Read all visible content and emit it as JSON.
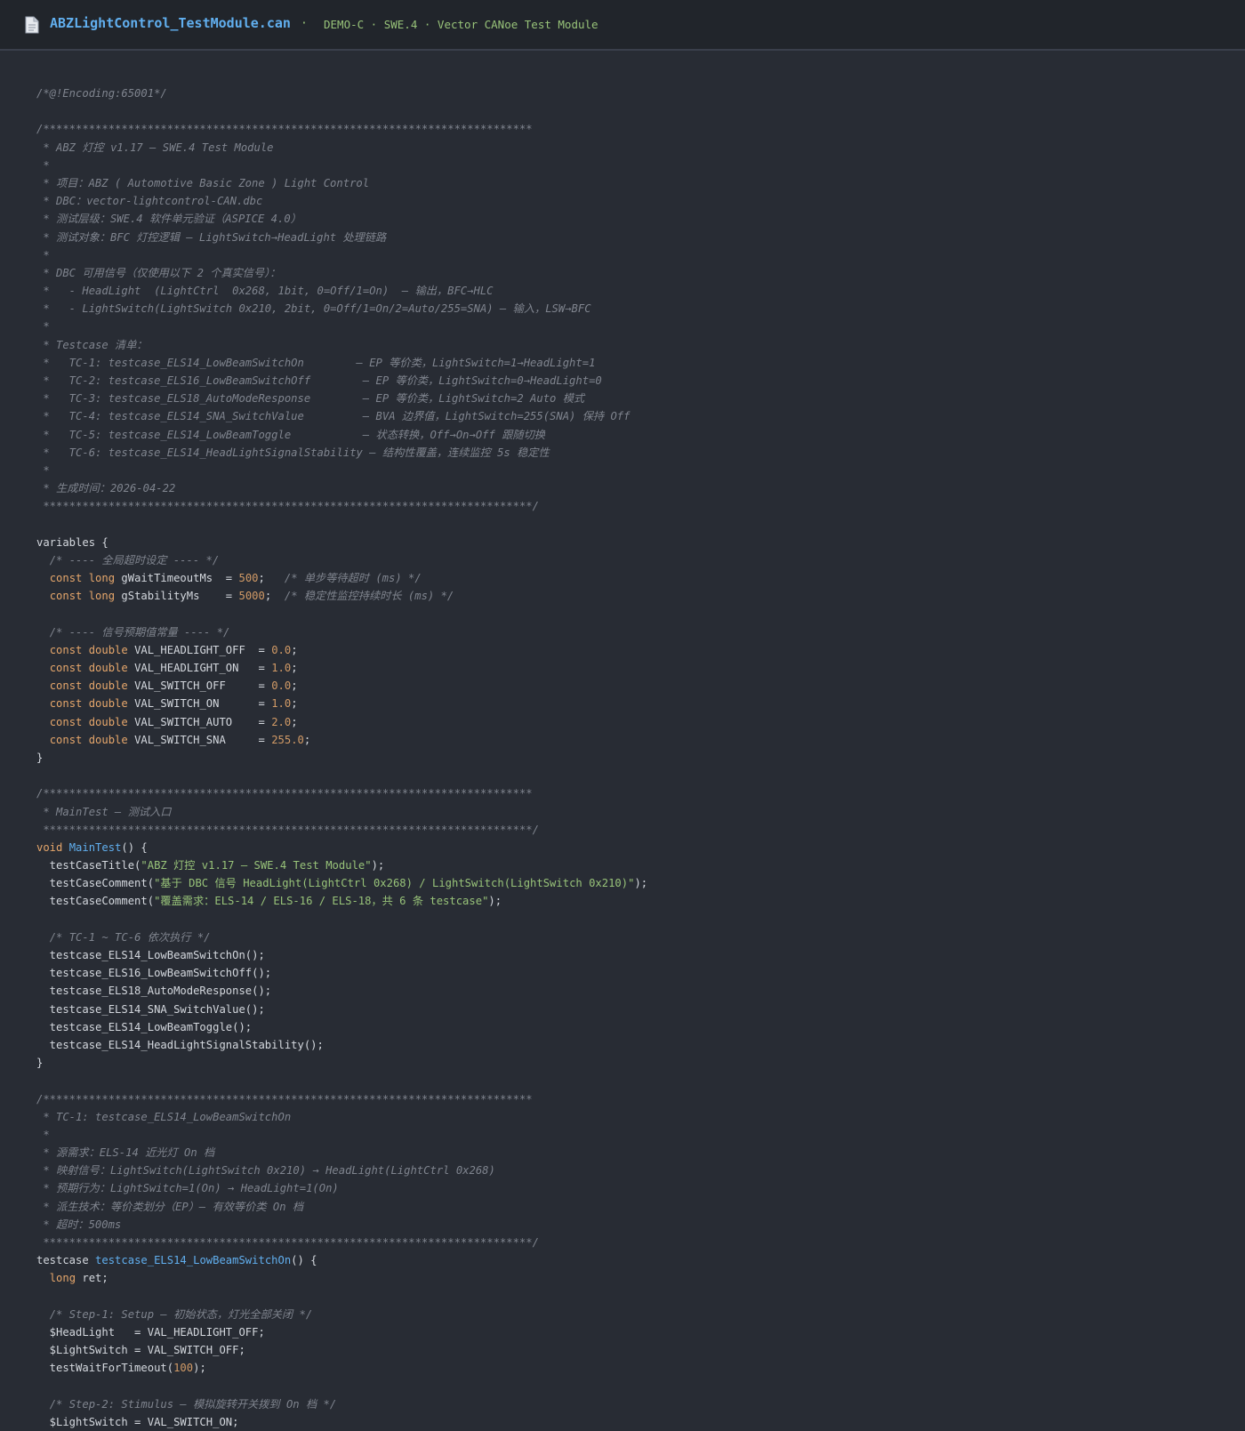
{
  "header": {
    "file_icon": "document-icon",
    "filename": "ABZLightControl_TestModule.can",
    "separator": "·",
    "meta": "DEMO-C · SWE.4 · Vector CANoe Test Module"
  },
  "colors": {
    "background": "#282c34",
    "header_bg": "#21252b",
    "comment": "#7f848e",
    "keyword": "#e5a66b",
    "number": "#d19a66",
    "function": "#61afef",
    "string": "#98c379",
    "text": "#d4d8de"
  },
  "code": [
    [
      {
        "t": "c",
        "v": "/*@!Encoding:65001*/"
      }
    ],
    [],
    [
      {
        "t": "c",
        "v": "/***************************************************************************"
      }
    ],
    [
      {
        "t": "c",
        "v": " * ABZ 灯控 v1.17 — SWE.4 Test Module"
      }
    ],
    [
      {
        "t": "c",
        "v": " *"
      }
    ],
    [
      {
        "t": "c",
        "v": " * 项目：ABZ ( Automotive Basic Zone ) Light Control"
      }
    ],
    [
      {
        "t": "c",
        "v": " * DBC：vector-lightcontrol-CAN.dbc"
      }
    ],
    [
      {
        "t": "c",
        "v": " * 测试层级：SWE.4 软件单元验证（ASPICE 4.0）"
      }
    ],
    [
      {
        "t": "c",
        "v": " * 测试对象：BFC 灯控逻辑 — LightSwitch→HeadLight 处理链路"
      }
    ],
    [
      {
        "t": "c",
        "v": " *"
      }
    ],
    [
      {
        "t": "c",
        "v": " * DBC 可用信号（仅使用以下 2 个真实信号）："
      }
    ],
    [
      {
        "t": "c",
        "v": " *   - HeadLight  (LightCtrl  0x268, 1bit, 0=Off/1=On)  — 输出，BFC→HLC"
      }
    ],
    [
      {
        "t": "c",
        "v": " *   - LightSwitch(LightSwitch 0x210, 2bit, 0=Off/1=On/2=Auto/255=SNA) — 输入，LSW→BFC"
      }
    ],
    [
      {
        "t": "c",
        "v": " *"
      }
    ],
    [
      {
        "t": "c",
        "v": " * Testcase 清单："
      }
    ],
    [
      {
        "t": "c",
        "v": " *   TC-1: testcase_ELS14_LowBeamSwitchOn        — EP 等价类，LightSwitch=1→HeadLight=1"
      }
    ],
    [
      {
        "t": "c",
        "v": " *   TC-2: testcase_ELS16_LowBeamSwitchOff        — EP 等价类，LightSwitch=0→HeadLight=0"
      }
    ],
    [
      {
        "t": "c",
        "v": " *   TC-3: testcase_ELS18_AutoModeResponse        — EP 等价类，LightSwitch=2 Auto 模式"
      }
    ],
    [
      {
        "t": "c",
        "v": " *   TC-4: testcase_ELS14_SNA_SwitchValue         — BVA 边界值，LightSwitch=255(SNA) 保持 Off"
      }
    ],
    [
      {
        "t": "c",
        "v": " *   TC-5: testcase_ELS14_LowBeamToggle           — 状态转换，Off→On→Off 跟随切换"
      }
    ],
    [
      {
        "t": "c",
        "v": " *   TC-6: testcase_ELS14_HeadLightSignalStability — 结构性覆盖，连续监控 5s 稳定性"
      }
    ],
    [
      {
        "t": "c",
        "v": " *"
      }
    ],
    [
      {
        "t": "c",
        "v": " * 生成时间：2026-04-22"
      }
    ],
    [
      {
        "t": "c",
        "v": " ***************************************************************************/"
      }
    ],
    [],
    [
      {
        "t": "p",
        "v": "variables {"
      }
    ],
    [
      {
        "t": "p",
        "v": "  "
      },
      {
        "t": "c",
        "v": "/* ---- 全局超时设定 ---- */"
      }
    ],
    [
      {
        "t": "p",
        "v": "  "
      },
      {
        "t": "kw",
        "v": "const long"
      },
      {
        "t": "p",
        "v": " gWaitTimeoutMs  = "
      },
      {
        "t": "num",
        "v": "500"
      },
      {
        "t": "p",
        "v": ";   "
      },
      {
        "t": "c",
        "v": "/* 单步等待超时 (ms) */"
      }
    ],
    [
      {
        "t": "p",
        "v": "  "
      },
      {
        "t": "kw",
        "v": "const long"
      },
      {
        "t": "p",
        "v": " gStabilityMs    = "
      },
      {
        "t": "num",
        "v": "5000"
      },
      {
        "t": "p",
        "v": ";  "
      },
      {
        "t": "c",
        "v": "/* 稳定性监控持续时长 (ms) */"
      }
    ],
    [],
    [
      {
        "t": "p",
        "v": "  "
      },
      {
        "t": "c",
        "v": "/* ---- 信号预期值常量 ---- */"
      }
    ],
    [
      {
        "t": "p",
        "v": "  "
      },
      {
        "t": "kw",
        "v": "const double"
      },
      {
        "t": "p",
        "v": " VAL_HEADLIGHT_OFF  = "
      },
      {
        "t": "num",
        "v": "0.0"
      },
      {
        "t": "p",
        "v": ";"
      }
    ],
    [
      {
        "t": "p",
        "v": "  "
      },
      {
        "t": "kw",
        "v": "const double"
      },
      {
        "t": "p",
        "v": " VAL_HEADLIGHT_ON   = "
      },
      {
        "t": "num",
        "v": "1.0"
      },
      {
        "t": "p",
        "v": ";"
      }
    ],
    [
      {
        "t": "p",
        "v": "  "
      },
      {
        "t": "kw",
        "v": "const double"
      },
      {
        "t": "p",
        "v": " VAL_SWITCH_OFF     = "
      },
      {
        "t": "num",
        "v": "0.0"
      },
      {
        "t": "p",
        "v": ";"
      }
    ],
    [
      {
        "t": "p",
        "v": "  "
      },
      {
        "t": "kw",
        "v": "const double"
      },
      {
        "t": "p",
        "v": " VAL_SWITCH_ON      = "
      },
      {
        "t": "num",
        "v": "1.0"
      },
      {
        "t": "p",
        "v": ";"
      }
    ],
    [
      {
        "t": "p",
        "v": "  "
      },
      {
        "t": "kw",
        "v": "const double"
      },
      {
        "t": "p",
        "v": " VAL_SWITCH_AUTO    = "
      },
      {
        "t": "num",
        "v": "2.0"
      },
      {
        "t": "p",
        "v": ";"
      }
    ],
    [
      {
        "t": "p",
        "v": "  "
      },
      {
        "t": "kw",
        "v": "const double"
      },
      {
        "t": "p",
        "v": " VAL_SWITCH_SNA     = "
      },
      {
        "t": "num",
        "v": "255.0"
      },
      {
        "t": "p",
        "v": ";"
      }
    ],
    [
      {
        "t": "p",
        "v": "}"
      }
    ],
    [],
    [
      {
        "t": "c",
        "v": "/***************************************************************************"
      }
    ],
    [
      {
        "t": "c",
        "v": " * MainTest — 测试入口"
      }
    ],
    [
      {
        "t": "c",
        "v": " ***************************************************************************/"
      }
    ],
    [
      {
        "t": "kw",
        "v": "void"
      },
      {
        "t": "p",
        "v": " "
      },
      {
        "t": "fn",
        "v": "MainTest"
      },
      {
        "t": "p",
        "v": "() {"
      }
    ],
    [
      {
        "t": "p",
        "v": "  testCaseTitle("
      },
      {
        "t": "str",
        "v": "\"ABZ 灯控 v1.17 — SWE.4 Test Module\""
      },
      {
        "t": "p",
        "v": ");"
      }
    ],
    [
      {
        "t": "p",
        "v": "  testCaseComment("
      },
      {
        "t": "str",
        "v": "\"基于 DBC 信号 HeadLight(LightCtrl 0x268) / LightSwitch(LightSwitch 0x210)\""
      },
      {
        "t": "p",
        "v": ");"
      }
    ],
    [
      {
        "t": "p",
        "v": "  testCaseComment("
      },
      {
        "t": "str",
        "v": "\"覆盖需求：ELS-14 / ELS-16 / ELS-18，共 6 条 testcase\""
      },
      {
        "t": "p",
        "v": ");"
      }
    ],
    [],
    [
      {
        "t": "p",
        "v": "  "
      },
      {
        "t": "c",
        "v": "/* TC-1 ~ TC-6 依次执行 */"
      }
    ],
    [
      {
        "t": "p",
        "v": "  testcase_ELS14_LowBeamSwitchOn();"
      }
    ],
    [
      {
        "t": "p",
        "v": "  testcase_ELS16_LowBeamSwitchOff();"
      }
    ],
    [
      {
        "t": "p",
        "v": "  testcase_ELS18_AutoModeResponse();"
      }
    ],
    [
      {
        "t": "p",
        "v": "  testcase_ELS14_SNA_SwitchValue();"
      }
    ],
    [
      {
        "t": "p",
        "v": "  testcase_ELS14_LowBeamToggle();"
      }
    ],
    [
      {
        "t": "p",
        "v": "  testcase_ELS14_HeadLightSignalStability();"
      }
    ],
    [
      {
        "t": "p",
        "v": "}"
      }
    ],
    [],
    [
      {
        "t": "c",
        "v": "/***************************************************************************"
      }
    ],
    [
      {
        "t": "c",
        "v": " * TC-1: testcase_ELS14_LowBeamSwitchOn"
      }
    ],
    [
      {
        "t": "c",
        "v": " *"
      }
    ],
    [
      {
        "t": "c",
        "v": " * 源需求：ELS-14 近光灯 On 档"
      }
    ],
    [
      {
        "t": "c",
        "v": " * 映射信号：LightSwitch(LightSwitch 0x210) → HeadLight(LightCtrl 0x268)"
      }
    ],
    [
      {
        "t": "c",
        "v": " * 预期行为：LightSwitch=1(On) → HeadLight=1(On)"
      }
    ],
    [
      {
        "t": "c",
        "v": " * 派生技术：等价类划分（EP）— 有效等价类 On 档"
      }
    ],
    [
      {
        "t": "c",
        "v": " * 超时：500ms"
      }
    ],
    [
      {
        "t": "c",
        "v": " ***************************************************************************/"
      }
    ],
    [
      {
        "t": "p",
        "v": "testcase "
      },
      {
        "t": "fn",
        "v": "testcase_ELS14_LowBeamSwitchOn"
      },
      {
        "t": "p",
        "v": "() {"
      }
    ],
    [
      {
        "t": "p",
        "v": "  "
      },
      {
        "t": "kw",
        "v": "long"
      },
      {
        "t": "p",
        "v": " ret;"
      }
    ],
    [],
    [
      {
        "t": "p",
        "v": "  "
      },
      {
        "t": "c",
        "v": "/* Step-1: Setup — 初始状态，灯光全部关闭 */"
      }
    ],
    [
      {
        "t": "p",
        "v": "  $HeadLight   = VAL_HEADLIGHT_OFF;"
      }
    ],
    [
      {
        "t": "p",
        "v": "  $LightSwitch = VAL_SWITCH_OFF;"
      }
    ],
    [
      {
        "t": "p",
        "v": "  testWaitForTimeout("
      },
      {
        "t": "num",
        "v": "100"
      },
      {
        "t": "p",
        "v": ");"
      }
    ],
    [],
    [
      {
        "t": "p",
        "v": "  "
      },
      {
        "t": "c",
        "v": "/* Step-2: Stimulus — 模拟旋转开关拨到 On 档 */"
      }
    ],
    [
      {
        "t": "p",
        "v": "  $LightSwitch = VAL_SWITCH_ON;"
      }
    ]
  ]
}
